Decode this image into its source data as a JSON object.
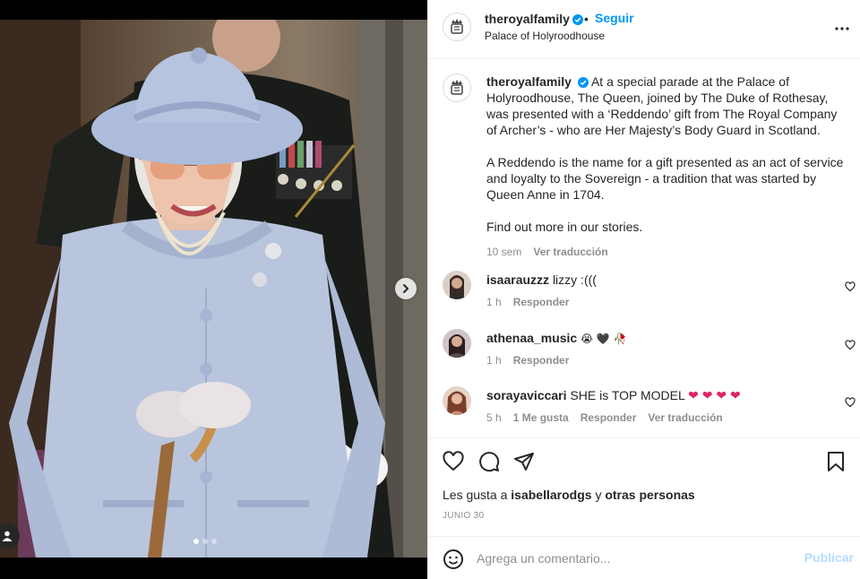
{
  "header": {
    "username": "theroyalfamily",
    "separator": "•",
    "follow_label": "Seguir",
    "location": "Palace of Holyroodhouse"
  },
  "caption": {
    "username": "theroyalfamily",
    "paragraph1": "At a special parade at the Palace of Holyroodhouse, The Queen, joined by The Duke of Rothesay, was presented with a ‘Reddendo’ gift from The Royal Company of Archer’s - who are Her Majesty’s Body Guard in Scotland.",
    "paragraph2": "A Reddendo is the name for a gift presented as an act of service and loyalty to the Sovereign - a tradition that was started by Queen Anne in 1704.",
    "paragraph3": "Find out more in our stories.",
    "time": "10 sem",
    "translate_label": "Ver traducción"
  },
  "comments": [
    {
      "username": "isaarauzzz",
      "text": "lizzy :(((",
      "time": "1 h",
      "reply_label": "Responder"
    },
    {
      "username": "athenaa_music",
      "text": "😭 🖤 🥀",
      "time": "1 h",
      "reply_label": "Responder"
    },
    {
      "username": "sorayaviccari",
      "text": "SHE is TOP MODEL",
      "hearts": "❤ ❤ ❤ ❤",
      "time": "5 h",
      "likes_label": "1 Me gusta",
      "reply_label": "Responder",
      "translate_label": "Ver traducción"
    }
  ],
  "likes": {
    "prefix": "Les gusta a",
    "user": "isabellarodgs",
    "joiner": "y",
    "others": "otras personas"
  },
  "post_date": "JUNIO 30",
  "add_comment": {
    "placeholder": "Agrega un comentario...",
    "post_label": "Publicar"
  },
  "icons": {
    "verified": "verified-badge-icon",
    "more": "more-options-icon",
    "like": "heart-icon",
    "comment": "comment-icon",
    "share": "share-icon",
    "save": "bookmark-icon",
    "emoji": "emoji-icon",
    "next": "chevron-right-icon",
    "tag": "user-tag-icon"
  },
  "colors": {
    "accent": "#0095f6",
    "post_disabled": "#b3dbff",
    "muted": "#8e8e8e",
    "heart_red": "#e0245e"
  },
  "carousel": {
    "count": 3,
    "active": 1
  }
}
